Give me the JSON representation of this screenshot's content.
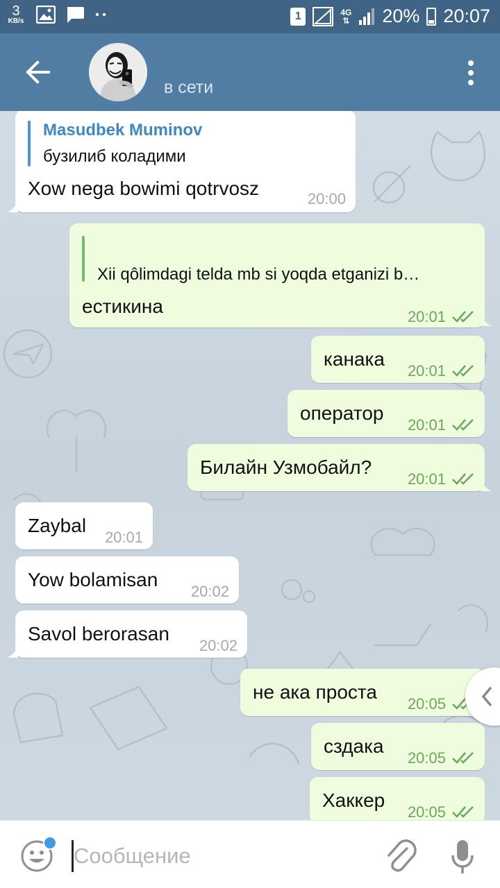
{
  "statusbar": {
    "speed_value": "3",
    "speed_unit": "KB/s",
    "sim_label": "1",
    "network": "4G",
    "battery": "20%",
    "time": "20:07"
  },
  "header": {
    "status": "в сети"
  },
  "messages": [
    {
      "direction": "in",
      "reply_name": "Masudbek Muminov",
      "reply_text": "бузилиб коладими",
      "text": "Xow nega bowimi qotrvosz",
      "time": "20:00"
    },
    {
      "direction": "out",
      "reply_text": "Xii qôlimdagi telda mb si yoqda etganizi b…",
      "text": "естикина",
      "time": "20:01"
    },
    {
      "direction": "out",
      "text": "канака",
      "time": "20:01"
    },
    {
      "direction": "out",
      "text": "оператор",
      "time": "20:01"
    },
    {
      "direction": "out",
      "text": "Билайн Узмобайл?",
      "time": "20:01"
    },
    {
      "direction": "in",
      "text": "Zaybal",
      "time": "20:01"
    },
    {
      "direction": "in",
      "text": "Yow bolamisan",
      "time": "20:02"
    },
    {
      "direction": "in",
      "text": "Savol berorasan",
      "time": "20:02"
    },
    {
      "direction": "out",
      "text": "не ака проста",
      "time": "20:05"
    },
    {
      "direction": "out",
      "text": "сздака",
      "time": "20:05"
    },
    {
      "direction": "out",
      "text": "Хаккер",
      "time": "20:05"
    }
  ],
  "input": {
    "placeholder": "Сообщение"
  },
  "icons": {
    "back": "arrow-back-icon",
    "menu": "more-vert-icon",
    "emoji": "smile-icon",
    "attach": "paperclip-icon",
    "mic": "microphone-icon",
    "read": "double-check-icon",
    "side": "chevron-left-icon"
  },
  "colors": {
    "header": "#527da3",
    "statusbar": "#3f6485",
    "incoming_bubble": "#ffffff",
    "outgoing_bubble": "#effdde",
    "outgoing_time": "#6aa85d",
    "reply_name": "#3e88c6"
  }
}
